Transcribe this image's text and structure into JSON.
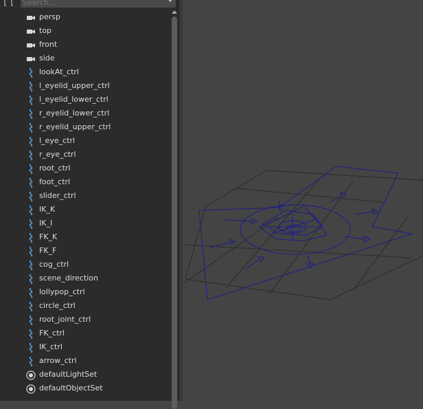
{
  "search": {
    "placeholder": "Search..."
  },
  "outliner": {
    "items": [
      {
        "label": "persp",
        "icon": "camera-icon"
      },
      {
        "label": "top",
        "icon": "camera-icon"
      },
      {
        "label": "front",
        "icon": "camera-icon"
      },
      {
        "label": "side",
        "icon": "camera-icon"
      },
      {
        "label": "lookAt_ctrl",
        "icon": "curve-icon"
      },
      {
        "label": "l_eyelid_upper_ctrl",
        "icon": "curve-icon"
      },
      {
        "label": "l_eyelid_lower_ctrl",
        "icon": "curve-icon"
      },
      {
        "label": "r_eyelid_lower_ctrl",
        "icon": "curve-icon"
      },
      {
        "label": "r_eyelid_upper_ctrl",
        "icon": "curve-icon"
      },
      {
        "label": "l_eye_ctrl",
        "icon": "curve-icon"
      },
      {
        "label": "r_eye_ctrl",
        "icon": "curve-icon"
      },
      {
        "label": "root_ctrl",
        "icon": "curve-icon"
      },
      {
        "label": "foot_ctrl",
        "icon": "curve-icon"
      },
      {
        "label": "slider_ctrl",
        "icon": "curve-icon"
      },
      {
        "label": "IK_K",
        "icon": "curve-icon"
      },
      {
        "label": "IK_I",
        "icon": "curve-icon"
      },
      {
        "label": "FK_K",
        "icon": "curve-icon"
      },
      {
        "label": "FK_F",
        "icon": "curve-icon"
      },
      {
        "label": "cog_ctrl",
        "icon": "curve-icon"
      },
      {
        "label": "scene_direction",
        "icon": "curve-icon"
      },
      {
        "label": "lollypop_ctrl",
        "icon": "curve-icon"
      },
      {
        "label": "circle_ctrl",
        "icon": "curve-icon"
      },
      {
        "label": "root_joint_ctrl",
        "icon": "curve-icon"
      },
      {
        "label": "FK_ctrl",
        "icon": "curve-icon"
      },
      {
        "label": "IK_ctrl",
        "icon": "curve-icon"
      },
      {
        "label": "arrow_ctrl",
        "icon": "curve-icon"
      },
      {
        "label": "defaultLightSet",
        "icon": "set-icon"
      },
      {
        "label": "defaultObjectSet",
        "icon": "set-icon"
      }
    ]
  },
  "colors": {
    "curve": "#5b9bd5",
    "wire": "#1c1c8c",
    "grid": "#2e2e2e"
  }
}
